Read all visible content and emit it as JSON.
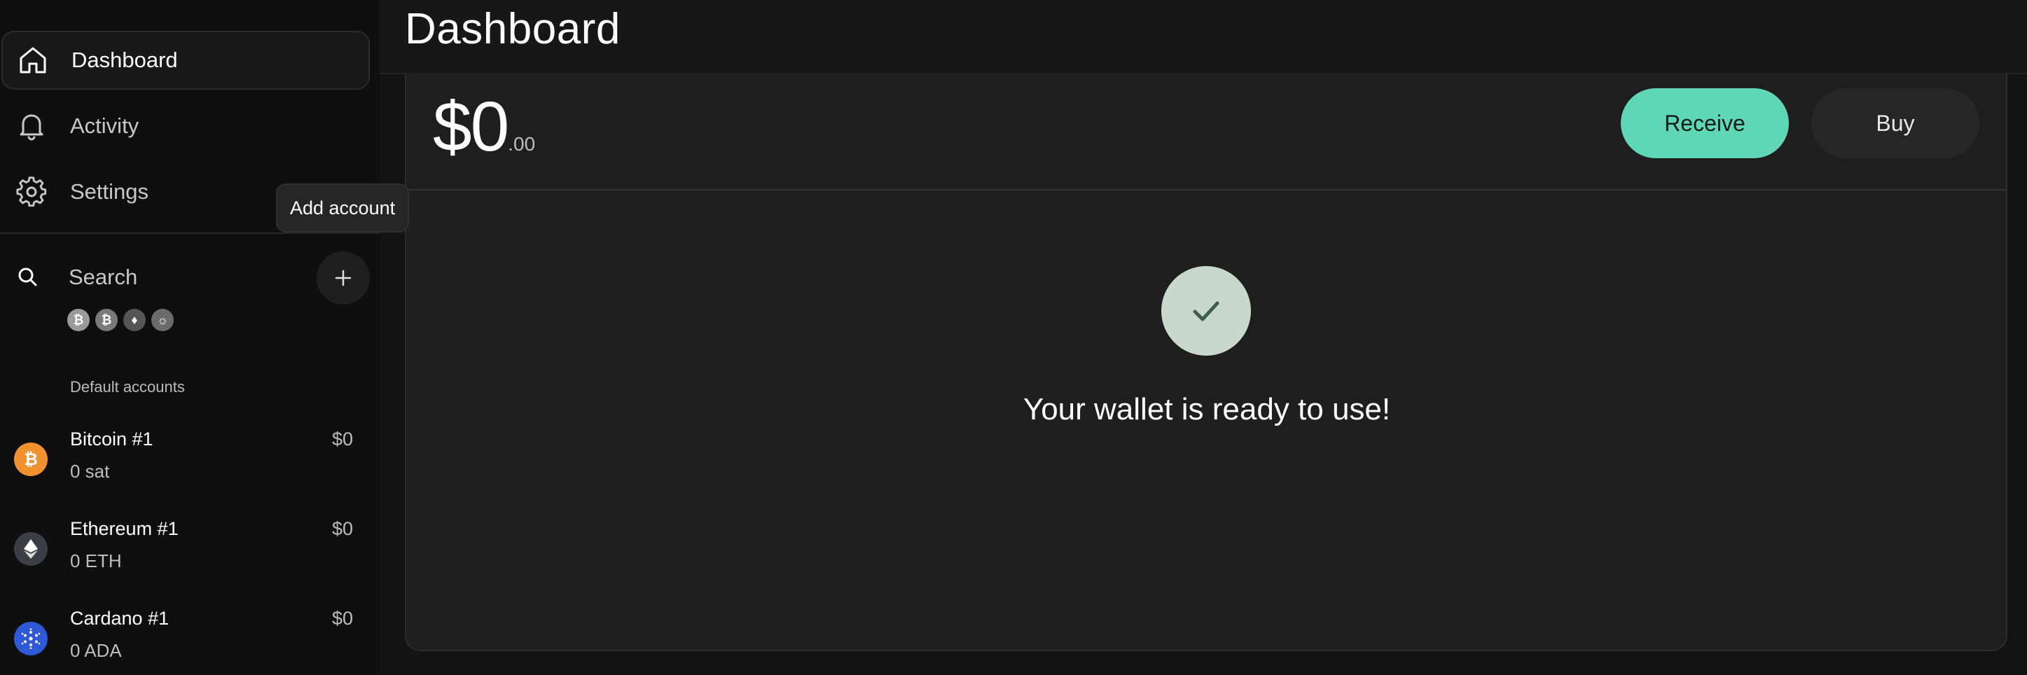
{
  "sidebar": {
    "nav": [
      {
        "label": "Dashboard",
        "icon": "home-icon"
      },
      {
        "label": "Activity",
        "icon": "bell-icon"
      },
      {
        "label": "Settings",
        "icon": "gear-icon"
      }
    ],
    "search": {
      "label": "Search"
    },
    "tooltip": "Add account",
    "chips": [
      {
        "glyph": "₿",
        "color": "#9a9a9a"
      },
      {
        "glyph": "₿",
        "color": "#7a7a7a"
      },
      {
        "glyph": "♦",
        "color": "#555555"
      },
      {
        "glyph": "☼",
        "color": "#6b6b6b"
      }
    ],
    "section_title": "Default accounts",
    "accounts": [
      {
        "name": "Bitcoin #1",
        "amount": "0 sat",
        "fiat": "$0",
        "icon": "bitcoin-icon",
        "color": "#f0912f"
      },
      {
        "name": "Ethereum #1",
        "amount": "0 ETH",
        "fiat": "$0",
        "icon": "ethereum-icon",
        "color": "#3d3d45"
      },
      {
        "name": "Cardano #1",
        "amount": "0 ADA",
        "fiat": "$0",
        "icon": "cardano-icon",
        "color": "#2e58d6"
      }
    ]
  },
  "main": {
    "title": "Dashboard",
    "balance": {
      "whole": "$0",
      "cents": ".00"
    },
    "buttons": {
      "receive": "Receive",
      "buy": "Buy"
    },
    "ready_message": "Your wallet is ready to use!"
  },
  "colors": {
    "accent": "#5fd6b4",
    "check_bg": "#c8d8cc",
    "check_mark": "#3e5e4a"
  }
}
